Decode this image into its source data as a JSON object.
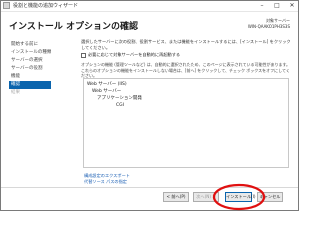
{
  "window": {
    "title": "役割と機能の追加ウィザード",
    "minimize_glyph": "–",
    "maximize_glyph": "□",
    "close_glyph": "✕"
  },
  "header": {
    "title": "インストール オプションの確認",
    "server_label": "対象サーバー",
    "server_name": "WIN-QAAKO1PH3S3S"
  },
  "nav": {
    "items": [
      {
        "label": "開始する前に",
        "state": "normal"
      },
      {
        "label": "インストールの種類",
        "state": "normal"
      },
      {
        "label": "サーバーの選択",
        "state": "normal"
      },
      {
        "label": "サーバーの役割",
        "state": "normal"
      },
      {
        "label": "機能",
        "state": "normal"
      },
      {
        "label": "確認",
        "state": "active"
      },
      {
        "label": "結果",
        "state": "disabled"
      }
    ]
  },
  "content": {
    "description": "選択したサーバーに次の役割、役割サービス、または機能をインストールするには、[インストール] をクリックしてください。",
    "restart_checkbox_label": "必要に応じて対象サーバーを自動的に再起動する",
    "restart_checked": false,
    "optional_note": "オプションの機能 (管理ツールなど) は、自動的に選択されたため、このページに表示されている可能性があります。これらのオプションの機能をインストールしない場合は、[前へ] をクリックして、チェック ボックスをオフにしてください。",
    "features": [
      {
        "label": "Web サーバー (IIS)",
        "level": 0
      },
      {
        "label": "Web サーバー",
        "level": 1
      },
      {
        "label": "アプリケーション開発",
        "level": 2
      },
      {
        "label": "CGI",
        "level": 3
      }
    ]
  },
  "links": {
    "export": "構成設定のエクスポート",
    "alt_source": "代替ソース パスの指定"
  },
  "buttons": {
    "prev": "< 前へ(P)",
    "next": "次へ(N) >",
    "install": "インストール(I)",
    "cancel": "キャンセル"
  },
  "annotation": {
    "color": "#e01010"
  }
}
